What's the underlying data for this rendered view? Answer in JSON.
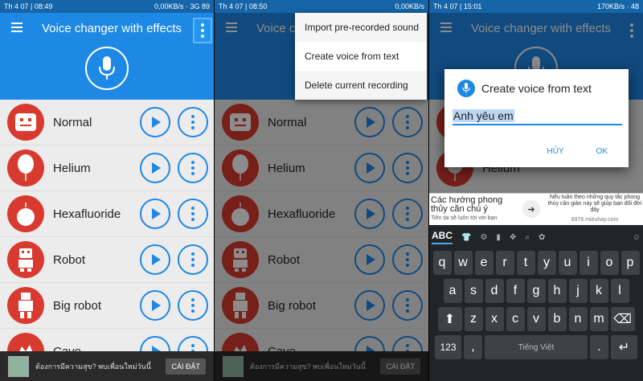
{
  "app": {
    "title": "Voice changer with effects"
  },
  "panels": [
    {
      "status_left": "Th 4 07 | 08:49",
      "status_right": "0,00KB/s  ·  3G  89"
    },
    {
      "status_left": "Th 4 07 | 08:50",
      "status_right": "0,00KB/s"
    },
    {
      "status_left": "Th 4 07 | 15:01",
      "status_right": "170KB/s  ·  48"
    }
  ],
  "voices": [
    "Normal",
    "Helium",
    "Hexafluoride",
    "Robot",
    "Big robot",
    "Cave"
  ],
  "ad": {
    "text": "ต้องการมีความสุข? พบเพื่อนใหม่วันนี้",
    "button": "CÀI ĐẶT"
  },
  "popup_menu": {
    "items": [
      "Import pre-recorded sound",
      "Create voice from text",
      "Delete current recording"
    ],
    "highlighted_index": 1
  },
  "dialog": {
    "title": "Create voice from text",
    "input_value": "Anh yêu em",
    "cancel": "HỦY",
    "ok": "OK"
  },
  "banner": {
    "title": "Các hướng phong thủy cần chú ý",
    "subtitle": "Tiền tài sẽ luôn tới với bạn",
    "right_text": "Nếu tuân theo những quy tắc phong thủy cần giản này sẽ giúp bạn đổi đời đấy",
    "link": "8976.mieuhay.com"
  },
  "keyboard": {
    "mode_label": "ABC",
    "row1": [
      "q",
      "w",
      "e",
      "r",
      "t",
      "y",
      "u",
      "i",
      "o",
      "p"
    ],
    "row2": [
      "a",
      "s",
      "d",
      "f",
      "g",
      "h",
      "j",
      "k",
      "l"
    ],
    "row3": [
      "z",
      "x",
      "c",
      "v",
      "b",
      "n",
      "m"
    ],
    "num_key": "123",
    "comma": ",",
    "space_label": "Tiếng Việt",
    "period": "."
  }
}
